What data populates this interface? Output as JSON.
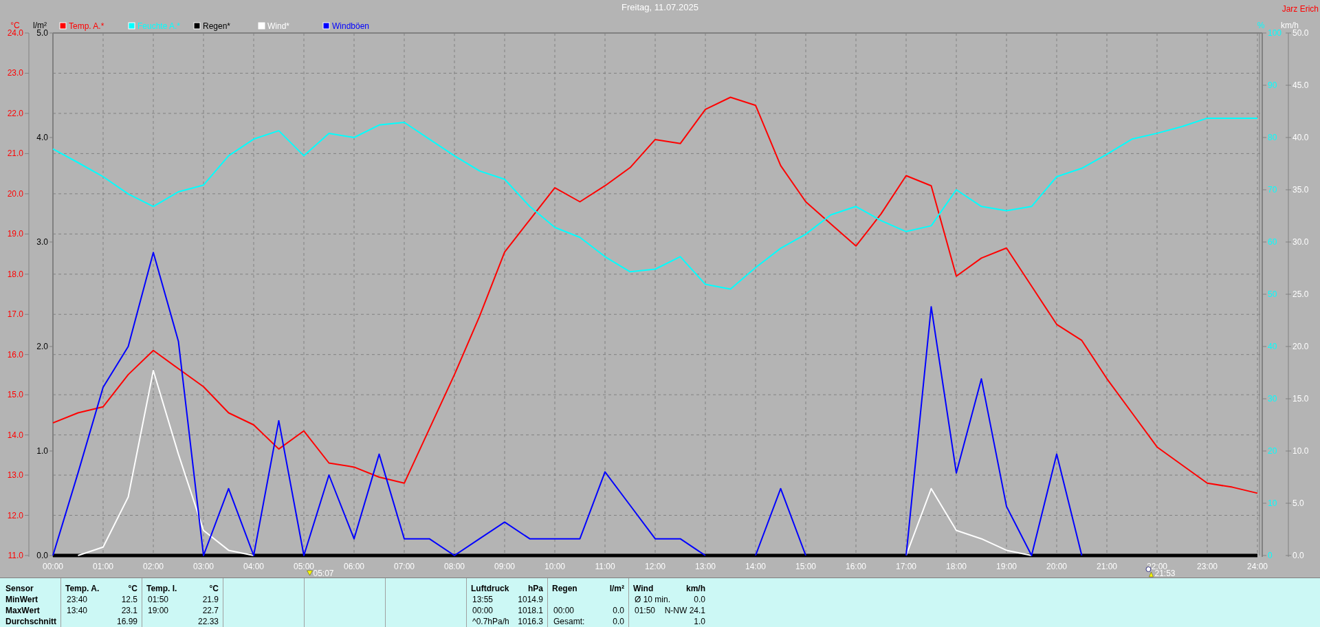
{
  "title": "Freitag, 11.07.2025",
  "author": "Jarz Erich",
  "chart_data": {
    "type": "line",
    "x": [
      0,
      0.5,
      1,
      1.5,
      2,
      2.5,
      3,
      3.5,
      4,
      4.5,
      5,
      5.5,
      6,
      6.5,
      7,
      7.5,
      8,
      8.5,
      9,
      9.5,
      10,
      10.5,
      11,
      11.5,
      12,
      12.5,
      13,
      13.5,
      14,
      14.5,
      15,
      15.5,
      16,
      16.5,
      17,
      17.5,
      18,
      18.5,
      19,
      19.5,
      20,
      20.5,
      21,
      21.5,
      22,
      22.5,
      23,
      23.5,
      24
    ],
    "xlim": [
      0,
      24
    ],
    "grid": true,
    "legend": "top",
    "xticks": [
      {
        "value": 0,
        "label": "00:00"
      },
      {
        "value": 1,
        "label": "01:00"
      },
      {
        "value": 2,
        "label": "02:00"
      },
      {
        "value": 3,
        "label": "03:00"
      },
      {
        "value": 4,
        "label": "04:00"
      },
      {
        "value": 5,
        "label": "05:00"
      },
      {
        "value": 6,
        "label": "06:00"
      },
      {
        "value": 7,
        "label": "07:00"
      },
      {
        "value": 8,
        "label": "08:00"
      },
      {
        "value": 9,
        "label": "09:00"
      },
      {
        "value": 10,
        "label": "10:00"
      },
      {
        "value": 11,
        "label": "11:00"
      },
      {
        "value": 12,
        "label": "12:00"
      },
      {
        "value": 13,
        "label": "13:00"
      },
      {
        "value": 14,
        "label": "14:00"
      },
      {
        "value": 15,
        "label": "15:00"
      },
      {
        "value": 16,
        "label": "16:00"
      },
      {
        "value": 17,
        "label": "17:00"
      },
      {
        "value": 18,
        "label": "18:00"
      },
      {
        "value": 19,
        "label": "19:00"
      },
      {
        "value": 20,
        "label": "20:00"
      },
      {
        "value": 21,
        "label": "21:00"
      },
      {
        "value": 22,
        "label": "22:00"
      },
      {
        "value": 23,
        "label": "23:00"
      },
      {
        "value": 24,
        "label": "24:00"
      }
    ],
    "ylabel": "°C",
    "ylim": [
      11,
      24
    ],
    "yticks": [
      {
        "value": 24,
        "label": "24.0"
      },
      {
        "value": 23,
        "label": "23.0"
      },
      {
        "value": 22,
        "label": "22.0"
      },
      {
        "value": 21,
        "label": "21.0"
      },
      {
        "value": 20,
        "label": "20.0"
      },
      {
        "value": 19,
        "label": "19.0"
      },
      {
        "value": 18,
        "label": "18.0"
      },
      {
        "value": 17,
        "label": "17.0"
      },
      {
        "value": 16,
        "label": "16.0"
      },
      {
        "value": 15,
        "label": "15.0"
      },
      {
        "value": 14,
        "label": "14.0"
      },
      {
        "value": 13,
        "label": "13.0"
      },
      {
        "value": 12,
        "label": "12.0"
      },
      {
        "value": 11,
        "label": "11.0"
      }
    ],
    "y2label": "%",
    "y2lim": [
      0,
      100
    ],
    "y2ticks": [
      {
        "value": 100,
        "label": "100"
      },
      {
        "value": 90,
        "label": "90"
      },
      {
        "value": 80,
        "label": "80"
      },
      {
        "value": 70,
        "label": "70"
      },
      {
        "value": 60,
        "label": "60"
      },
      {
        "value": 50,
        "label": "50"
      },
      {
        "value": 40,
        "label": "40"
      },
      {
        "value": 30,
        "label": "30"
      },
      {
        "value": 20,
        "label": "20"
      },
      {
        "value": 10,
        "label": "10"
      },
      {
        "value": 0,
        "label": "0"
      }
    ],
    "y3label": "km/h",
    "y3lim": [
      0,
      50
    ],
    "y3ticks": [
      {
        "value": 50,
        "label": "50.0"
      },
      {
        "value": 45,
        "label": "45.0"
      },
      {
        "value": 40,
        "label": "40.0"
      },
      {
        "value": 35,
        "label": "35.0"
      },
      {
        "value": 30,
        "label": "30.0"
      },
      {
        "value": 25,
        "label": "25.0"
      },
      {
        "value": 20,
        "label": "20.0"
      },
      {
        "value": 15,
        "label": "15.0"
      },
      {
        "value": 10,
        "label": "10.0"
      },
      {
        "value": 5,
        "label": "5.0"
      },
      {
        "value": 0,
        "label": "0.0"
      }
    ],
    "series": [
      {
        "name": "Temp. A.*",
        "color": "#ff0000",
        "values": [
          14.3,
          14.55,
          14.7,
          15.5,
          16.1,
          15.65,
          15.2,
          14.55,
          14.25,
          13.65,
          14.1,
          13.3,
          13.2,
          12.95,
          12.8,
          14.15,
          15.5,
          16.95,
          18.55,
          19.35,
          20.15,
          19.8,
          20.2,
          20.65,
          21.35,
          21.25,
          22.1,
          22.4,
          22.2,
          20.7,
          19.8,
          19.25,
          18.7,
          19.5,
          20.45,
          20.2,
          17.95,
          18.4,
          18.65,
          17.7,
          16.75,
          16.35,
          15.4,
          14.55,
          13.7,
          13.25,
          12.8,
          12.7,
          12.55
        ]
      },
      {
        "name": "Feuchte A.*",
        "color": "#00ffff",
        "axis": "y2",
        "values": [
          77.8,
          75.2,
          72.5,
          69.2,
          66.8,
          69.6,
          70.9,
          76.5,
          79.7,
          81.3,
          76.5,
          80.8,
          80.0,
          82.4,
          82.9,
          79.7,
          76.5,
          73.6,
          72.0,
          66.8,
          62.8,
          60.9,
          57.2,
          54.3,
          54.8,
          57.2,
          51.9,
          51.0,
          55.1,
          58.8,
          61.5,
          65.2,
          66.8,
          64.1,
          62.0,
          63.1,
          70.0,
          66.8,
          66.0,
          66.8,
          72.5,
          74.1,
          76.8,
          79.7,
          80.8,
          82.1,
          83.7,
          83.7,
          83.7
        ]
      },
      {
        "name": "Regen*",
        "color": "#000000",
        "axis": "y3",
        "values": [
          0,
          0,
          0,
          0,
          0,
          0,
          0,
          0,
          0,
          0,
          0,
          0,
          0,
          0,
          0,
          0,
          0,
          0,
          0,
          0,
          0,
          0,
          0,
          0,
          0,
          0,
          0,
          0,
          0,
          0,
          0,
          0,
          0,
          0,
          0,
          0,
          0,
          0,
          0,
          0,
          0,
          0,
          0,
          0,
          0,
          0,
          0,
          0,
          0
        ]
      },
      {
        "name": "Wind*",
        "color": "#ffffff",
        "axis": "y3",
        "values": [
          null,
          0,
          0.8,
          5.6,
          17.7,
          9.7,
          2.4,
          0.5,
          0,
          null,
          null,
          null,
          null,
          null,
          null,
          null,
          null,
          null,
          null,
          null,
          null,
          null,
          null,
          null,
          null,
          null,
          null,
          null,
          null,
          null,
          null,
          null,
          null,
          null,
          0,
          6.4,
          2.4,
          1.6,
          0.5,
          0,
          null,
          null,
          null,
          null,
          null,
          null,
          null,
          null,
          null
        ]
      },
      {
        "name": "Windböen",
        "color": "#0000ff",
        "axis": "y3",
        "values": [
          0,
          7.9,
          16.1,
          20.0,
          29.0,
          20.5,
          0,
          6.4,
          0,
          12.9,
          0,
          7.7,
          1.6,
          9.7,
          1.6,
          1.6,
          0,
          1.6,
          3.2,
          1.6,
          1.6,
          1.6,
          8.0,
          4.8,
          1.6,
          1.6,
          0,
          null,
          0,
          6.4,
          0,
          null,
          null,
          null,
          0,
          23.8,
          7.9,
          16.9,
          4.7,
          0,
          9.7,
          0,
          null,
          null,
          null,
          null,
          null,
          null,
          null
        ]
      }
    ]
  },
  "rain_axis": {
    "unit": "l/m²",
    "ticks": [
      "5.0",
      "4.0",
      "3.0",
      "2.0",
      "1.0",
      "0.0"
    ]
  },
  "sun_times": [
    {
      "kind": "sunrise",
      "time": "05:07"
    },
    {
      "kind": "sunset",
      "time": "21:53"
    }
  ],
  "stats": {
    "row_labels": [
      "Sensor",
      "MinWert",
      "MaxWert",
      "Durchschnitt"
    ],
    "blocks": [
      {
        "kind": "data",
        "title": "Temp. A.",
        "unit": "°C",
        "rows": [
          {
            "time": "23:40",
            "value": "12.5"
          },
          {
            "time": "13:40",
            "value": "23.1"
          },
          {
            "value": "16.99"
          }
        ]
      },
      {
        "kind": "data",
        "title": "Temp. I.",
        "unit": "°C",
        "rows": [
          {
            "time": "01:50",
            "value": "21.9"
          },
          {
            "time": "19:00",
            "value": "22.7"
          },
          {
            "value": "22.33"
          }
        ]
      },
      {
        "kind": "empty"
      },
      {
        "kind": "empty"
      },
      {
        "kind": "empty"
      },
      {
        "kind": "data",
        "title": "Luftdruck",
        "unit": "hPa",
        "rows": [
          {
            "time": "13:55",
            "value": "1014.9"
          },
          {
            "time": "00:00",
            "value": "1018.1"
          },
          {
            "time": "^0.7hPa/h",
            "value": "1016.3"
          }
        ]
      },
      {
        "kind": "data",
        "title": "Regen",
        "unit": "l/m²",
        "rows": [
          {},
          {
            "time": "00:00",
            "value": "0.0"
          },
          {
            "time": "Gesamt:",
            "value": "0.0"
          }
        ]
      },
      {
        "kind": "data",
        "title": "Wind",
        "unit": "km/h",
        "rows": [
          {
            "time": "Ø 10 min.",
            "value": "0.0"
          },
          {
            "time": "01:50",
            "value": "N-NW 24.1"
          },
          {
            "value": "1.0"
          }
        ]
      }
    ]
  }
}
